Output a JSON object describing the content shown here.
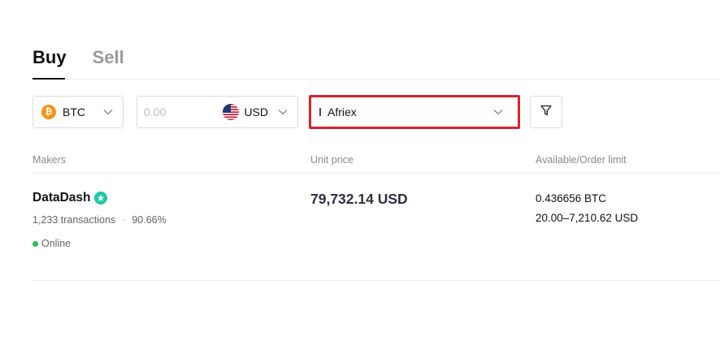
{
  "tabs": [
    {
      "label": "Buy",
      "active": true
    },
    {
      "label": "Sell",
      "active": false
    }
  ],
  "filters": {
    "crypto": {
      "value": "BTC",
      "icon": "bitcoin-icon",
      "color": "#f7931a"
    },
    "amount": {
      "placeholder": "0.00",
      "value": ""
    },
    "fiat": {
      "value": "USD",
      "icon": "us-flag-icon"
    },
    "payment_method": {
      "value": "Afriex",
      "highlight_color": "#d8232a"
    },
    "filter_button_icon": "filter-icon"
  },
  "table": {
    "columns": [
      "Makers",
      "Unit price",
      "Available/Order limit"
    ],
    "rows": [
      {
        "maker": "DataDash",
        "verified": true,
        "transactions": "1,233 transactions",
        "completion": "90.66%",
        "status": "Online",
        "unit_price": "79,732.14 USD",
        "available": "0.436656 BTC",
        "limit": "20.00–7,210.62 USD"
      }
    ]
  },
  "colors": {
    "online": "#2ebd5f",
    "verified_badge": "#1fc7a4",
    "accent_red": "#d8232a"
  }
}
